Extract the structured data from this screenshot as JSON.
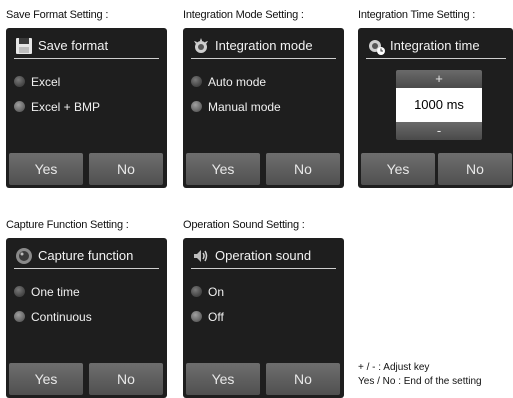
{
  "panels": {
    "save_format": {
      "caption": "Save Format Setting :",
      "header": "Save format",
      "icon": "floppy-disk-icon",
      "options": [
        "Excel",
        "Excel + BMP"
      ],
      "yes": "Yes",
      "no": "No"
    },
    "integration_mode": {
      "caption": "Integration Mode Setting :",
      "header": "Integration mode",
      "icon": "integration-icon",
      "options": [
        "Auto mode",
        "Manual mode"
      ],
      "yes": "Yes",
      "no": "No"
    },
    "integration_time": {
      "caption": "Integration Time Setting :",
      "header": "Integration time",
      "icon": "integration-clock-icon",
      "plus": "+",
      "minus": "-",
      "value": "1000 ms",
      "yes": "Yes",
      "no": "No"
    },
    "capture_function": {
      "caption": "Capture Function Setting :",
      "header": "Capture function",
      "icon": "camera-lens-icon",
      "options": [
        "One time",
        "Continuous"
      ],
      "yes": "Yes",
      "no": "No"
    },
    "operation_sound": {
      "caption": "Operation Sound Setting :",
      "header": "Operation sound",
      "icon": "speaker-icon",
      "options": [
        "On",
        "Off"
      ],
      "yes": "Yes",
      "no": "No"
    }
  },
  "legend": {
    "line1": "+ / - : Adjust key",
    "line2": "Yes / No : End of the setting"
  },
  "colors": {
    "screen_bg": "#1e1e1e",
    "button": "#5e5e5e",
    "text": "#f0f0f0"
  }
}
